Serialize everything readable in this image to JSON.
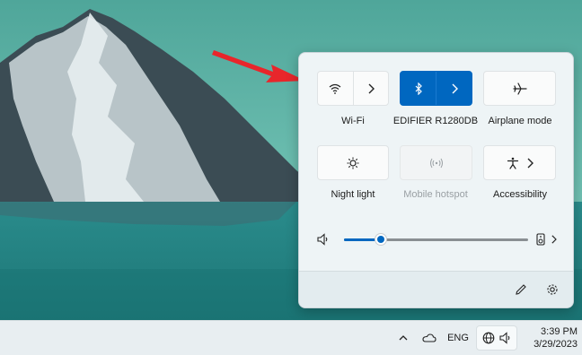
{
  "quick_settings": {
    "tiles": [
      {
        "label": "Wi-Fi",
        "icon": "wifi-icon",
        "state": "off",
        "has_expand": true
      },
      {
        "label": "EDIFIER R1280DB",
        "icon": "bluetooth-icon",
        "state": "on",
        "has_expand": true
      },
      {
        "label": "Airplane mode",
        "icon": "airplane-icon",
        "state": "off",
        "has_expand": false
      },
      {
        "label": "Night light",
        "icon": "night-light-icon",
        "state": "off",
        "has_expand": false
      },
      {
        "label": "Mobile hotspot",
        "icon": "hotspot-icon",
        "state": "disabled",
        "has_expand": false
      },
      {
        "label": "Accessibility",
        "icon": "accessibility-icon",
        "state": "off",
        "has_expand": true
      }
    ],
    "volume": {
      "level_percent": 20,
      "icon": "speaker-icon",
      "output_icon": "speaker-device-icon"
    },
    "footer": {
      "edit_icon": "pencil-icon",
      "settings_icon": "gear-icon"
    }
  },
  "taskbar": {
    "language": "ENG",
    "time": "3:39 PM",
    "date": "3/29/2023"
  },
  "colors": {
    "accent": "#0067c0",
    "annotation_arrow": "#e8262b"
  }
}
